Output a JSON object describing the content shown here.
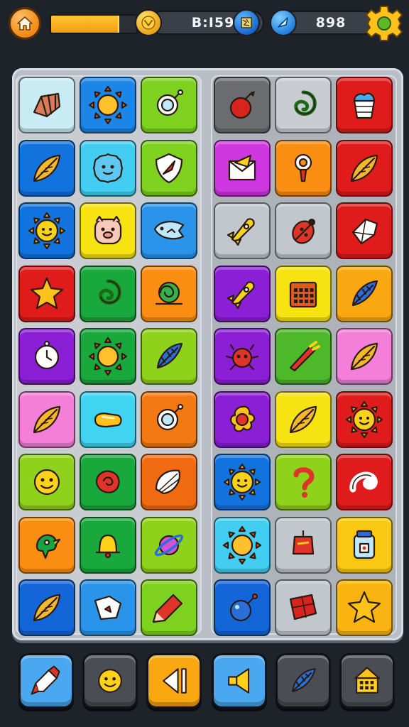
{
  "hud": {
    "home_icon": "home-icon",
    "level_progress": 0.78,
    "coins_value": "B:I59",
    "gems_value": "898",
    "coin_icon": "coin-icon",
    "map_icon": "map-icon",
    "gem_icon": "gem-icon",
    "settings_icon": "gear-icon"
  },
  "board": {
    "left_panel": [
      [
        "#c9ecf4",
        "seashell-icon"
      ],
      [
        "#1c86e8",
        "sun-icon"
      ],
      [
        "#7fd11f",
        "magnifier-icon"
      ],
      [
        "#1373de",
        "leaf-icon"
      ],
      [
        "#44cdf2",
        "blob-face-icon"
      ],
      [
        "#7fd11f",
        "shield-icon"
      ],
      [
        "#1373de",
        "sun-face-icon"
      ],
      [
        "#f7e311",
        "pig-face-icon"
      ],
      [
        "#2a93ea",
        "fish-icon"
      ],
      [
        "#e01b1b",
        "star-icon"
      ],
      [
        "#19a83c",
        "swirl-icon"
      ],
      [
        "#f98e12",
        "snail-icon"
      ],
      [
        "#8b1fd6",
        "clock-icon"
      ],
      [
        "#19a83c",
        "sun-icon"
      ],
      [
        "#8fd21c",
        "feather-icon"
      ],
      [
        "#f37fd9",
        "leaf-icon"
      ],
      [
        "#41d4f2",
        "candy-icon"
      ],
      [
        "#f37a12",
        "magnifier-icon"
      ],
      [
        "#8fd21c",
        "smile-face-icon"
      ],
      [
        "#19a83c",
        "rose-icon"
      ],
      [
        "#f06a12",
        "shell-icon"
      ],
      [
        "#f98e12",
        "bird-icon"
      ],
      [
        "#19a83c",
        "bell-icon"
      ],
      [
        "#8fd21c",
        "planet-icon"
      ],
      [
        "#1466d8",
        "leaf-icon"
      ],
      [
        "#2a93ea",
        "paper-icon"
      ],
      [
        "#7fd11f",
        "crayon-icon"
      ]
    ],
    "right_panel": [
      [
        "#6a6c6f",
        "berry-icon"
      ],
      [
        "#c9ccd0",
        "swirl-icon"
      ],
      [
        "#e01b1b",
        "cup-icon"
      ],
      [
        "#cf38e0",
        "envelope-icon"
      ],
      [
        "#f98e12",
        "key-icon"
      ],
      [
        "#e01b1b",
        "leaf-icon"
      ],
      [
        "#c2c7cd",
        "rocket-icon"
      ],
      [
        "#c2c7cd",
        "ladybug-icon"
      ],
      [
        "#e01b1b",
        "crystal-icon"
      ],
      [
        "#8b1fd6",
        "rocket-icon"
      ],
      [
        "#f7e311",
        "calendar-icon"
      ],
      [
        "#f9a812",
        "feather-icon"
      ],
      [
        "#8b1fd6",
        "bug-face-icon"
      ],
      [
        "#4cb82a",
        "carrot-icon"
      ],
      [
        "#f37fd9",
        "leaf-icon"
      ],
      [
        "#8b1fd6",
        "flower-icon"
      ],
      [
        "#f7e311",
        "leaf-icon"
      ],
      [
        "#e01b1b",
        "sun-face-icon"
      ],
      [
        "#1373de",
        "sun-face-icon"
      ],
      [
        "#8fd21c",
        "question-icon"
      ],
      [
        "#e01b1b",
        "snake-icon"
      ],
      [
        "#44cdf2",
        "sun-icon"
      ],
      [
        "#c2c7cd",
        "lantern-icon"
      ],
      [
        "#f9c812",
        "jar-icon"
      ],
      [
        "#1466d8",
        "bomb-icon"
      ],
      [
        "#c2c7cd",
        "gift-icon"
      ],
      [
        "#f9b412",
        "star-icon"
      ]
    ]
  },
  "toolbar": [
    [
      "#4aa8f0",
      "paintbrush-icon"
    ],
    [
      "#4a4d53",
      "smile-face-icon"
    ],
    [
      "#f9a812",
      "back-icon"
    ],
    [
      "#4aa8f0",
      "megaphone-icon"
    ],
    [
      "#4a4d53",
      "feather-icon"
    ],
    [
      "#4a4d53",
      "shop-icon"
    ]
  ]
}
